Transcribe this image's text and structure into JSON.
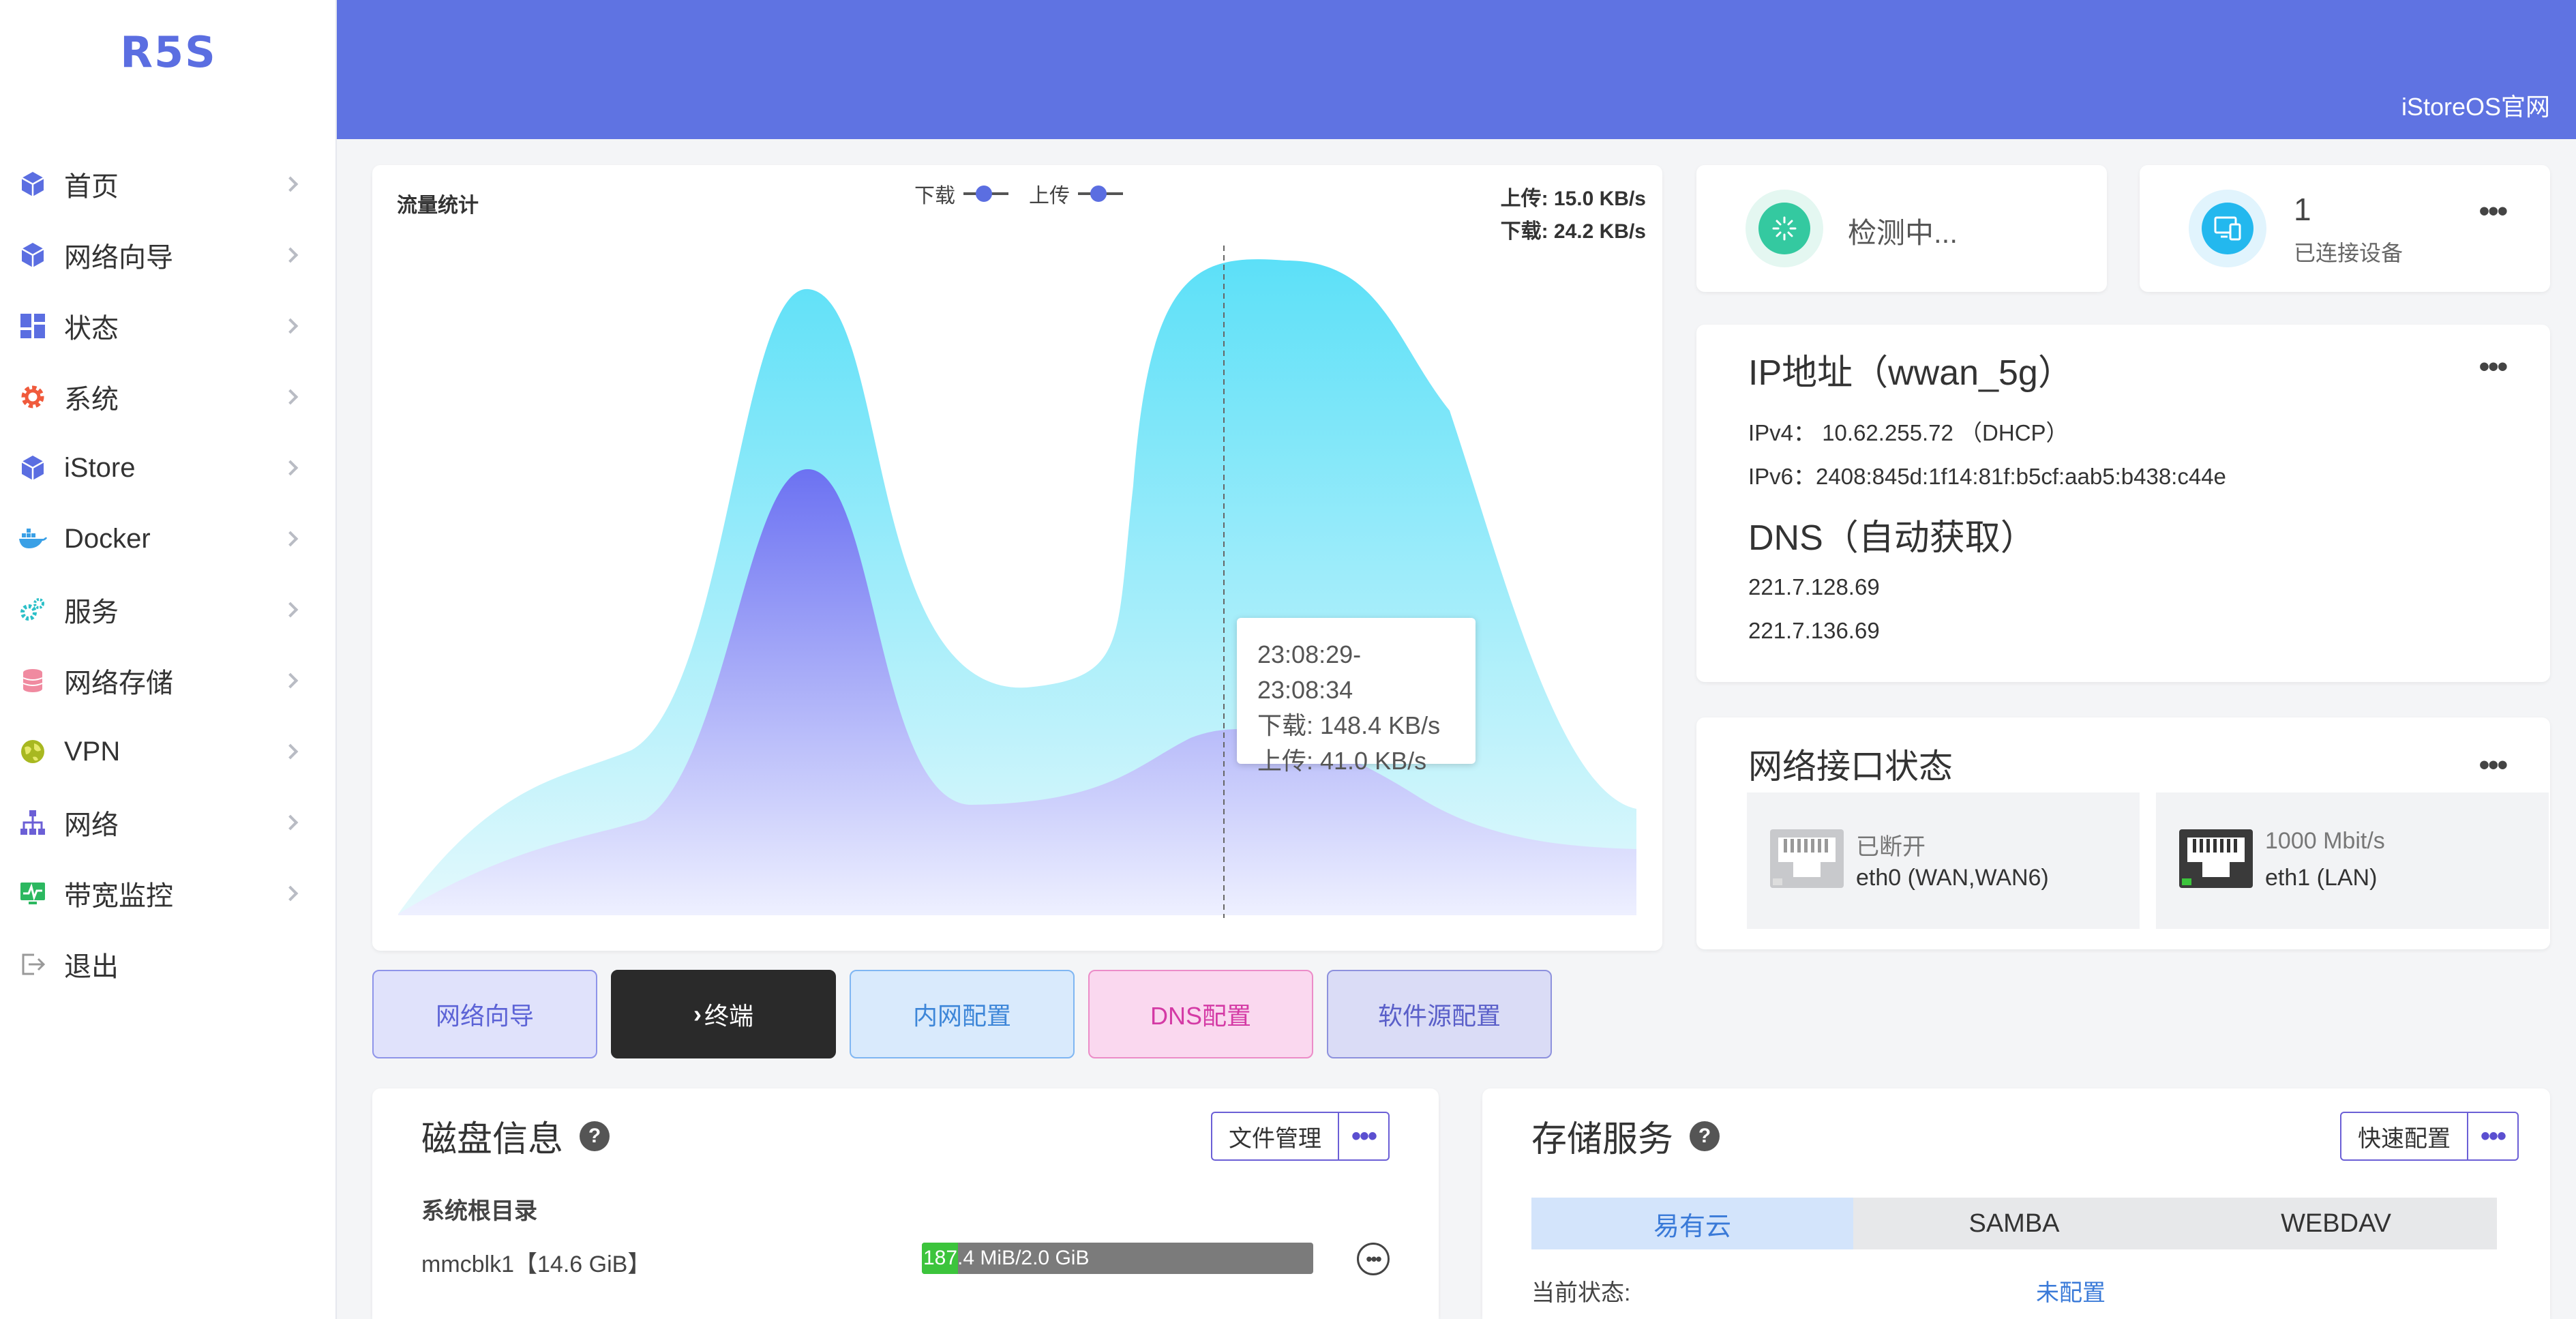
{
  "brand": "R5S",
  "header": {
    "link": "iStoreOS官网"
  },
  "sidebar": {
    "items": [
      {
        "label": "首页",
        "icon": "cube-icon",
        "color": "#5b6ee1"
      },
      {
        "label": "网络向导",
        "icon": "cube-icon",
        "color": "#5b6ee1"
      },
      {
        "label": "状态",
        "icon": "dashboard-icon",
        "color": "#5b6ee1"
      },
      {
        "label": "系统",
        "icon": "gear-icon",
        "color": "#f05a3c"
      },
      {
        "label": "iStore",
        "icon": "cube-icon",
        "color": "#5b6ee1"
      },
      {
        "label": "Docker",
        "icon": "docker-icon",
        "color": "#3aa0e6"
      },
      {
        "label": "服务",
        "icon": "services-icon",
        "color": "#2cc0c8"
      },
      {
        "label": "网络存储",
        "icon": "database-icon",
        "color": "#f08aa0"
      },
      {
        "label": "VPN",
        "icon": "globe-icon",
        "color": "#a8b820"
      },
      {
        "label": "网络",
        "icon": "network-icon",
        "color": "#6b5fd6"
      },
      {
        "label": "带宽监控",
        "icon": "monitor-icon",
        "color": "#2cb860"
      },
      {
        "label": "退出",
        "icon": "logout-icon",
        "color": "#999999"
      }
    ]
  },
  "traffic": {
    "title": "流量统计",
    "legend_download": "下载",
    "legend_upload": "上传",
    "rate_upload": "上传: 15.0 KB/s",
    "rate_download": "下载: 24.2 KB/s",
    "tooltip": {
      "time": "23:08:29-23:08:34",
      "download": "下载: 148.4 KB/s",
      "upload": "上传: 41.0 KB/s"
    }
  },
  "quick_buttons": {
    "wizard": "网络向导",
    "terminal": "终端",
    "lan": "内网配置",
    "dns": "DNS配置",
    "source": "软件源配置"
  },
  "status_cards": {
    "detect": "检测中...",
    "devices_count": "1",
    "devices_label": "已连接设备"
  },
  "ip": {
    "title": "IP地址（wwan_5g）",
    "ipv4": "IPv4： 10.62.255.72 （DHCP）",
    "ipv6": "IPv6：2408:845d:1f14:81f:b5cf:aab5:b438:c44e",
    "dns_title": "DNS（自动获取）",
    "dns1": "221.7.128.69",
    "dns2": "221.7.136.69"
  },
  "net_ifaces": {
    "title": "网络接口状态",
    "ports": [
      {
        "status": "已断开",
        "name": "eth0 (WAN,WAN6)",
        "connected": false
      },
      {
        "status": "1000 Mbit/s",
        "name": "eth1 (LAN)",
        "connected": true
      }
    ]
  },
  "disk": {
    "title": "磁盘信息",
    "btn": "文件管理",
    "section": "系统根目录",
    "device": "mmcblk1【14.6 GiB】",
    "usage_text": "187.4 MiB/2.0 GiB",
    "usage_fraction": 0.0915
  },
  "storage": {
    "title": "存储服务",
    "btn": "快速配置",
    "tabs": [
      "易有云",
      "SAMBA",
      "WEBDAV"
    ],
    "status_label": "当前状态:",
    "status_value": "未配置"
  }
}
